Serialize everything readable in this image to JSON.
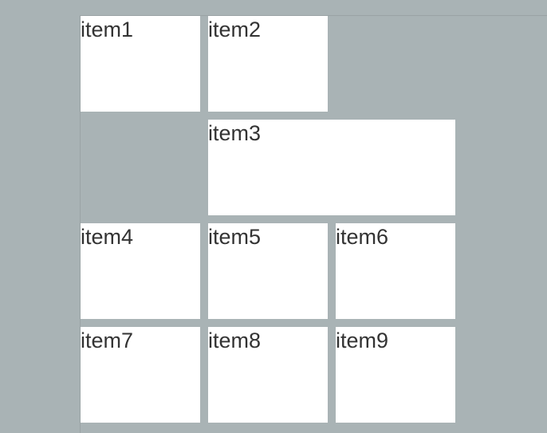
{
  "grid": {
    "items": [
      {
        "label": "item1"
      },
      {
        "label": "item2"
      },
      {
        "label": "item3"
      },
      {
        "label": "item4"
      },
      {
        "label": "item5"
      },
      {
        "label": "item6"
      },
      {
        "label": "item7"
      },
      {
        "label": "item8"
      },
      {
        "label": "item9"
      }
    ]
  }
}
